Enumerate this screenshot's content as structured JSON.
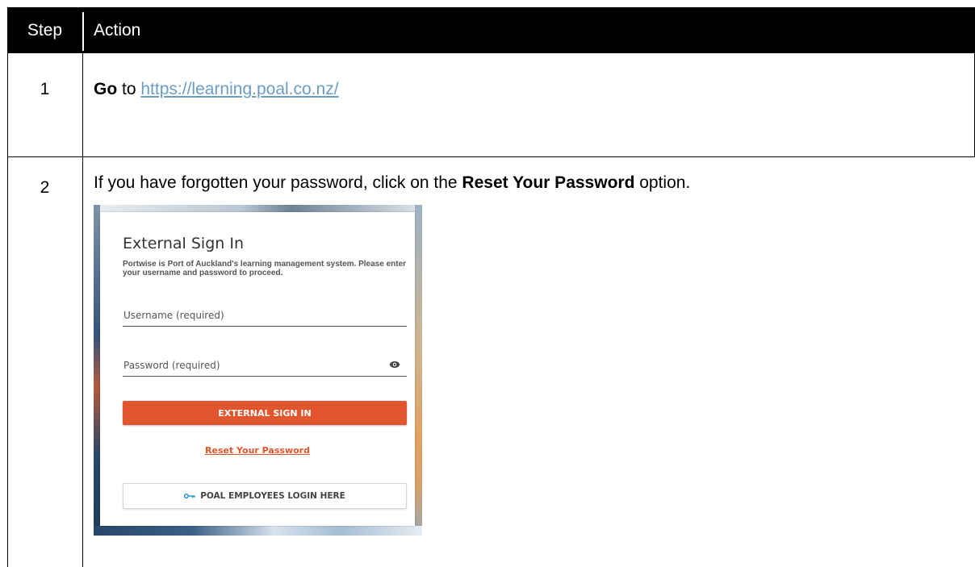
{
  "table": {
    "header": {
      "step": "Step",
      "action": "Action"
    },
    "rows": [
      {
        "step": "1",
        "verb": "Go",
        "connector": "to",
        "url": "https://learning.poal.co.nz/"
      },
      {
        "step": "2",
        "text_before": "If you have forgotten your password, click on the",
        "bold": "Reset Your Password",
        "text_after": "option."
      }
    ]
  },
  "signin": {
    "title": "External Sign In",
    "description": "Portwise is Port of Auckland's learning management system. Please enter your username and password to proceed.",
    "username_label": "Username  (required)",
    "password_label": "Password (required)",
    "signin_button": "EXTERNAL SIGN IN",
    "reset_link": "Reset Your Password",
    "employees_button": "POAL EMPLOYEES LOGIN HERE"
  },
  "colors": {
    "accent": "#e0552e",
    "link": "#6b9cc3",
    "header_bg": "#000000"
  }
}
